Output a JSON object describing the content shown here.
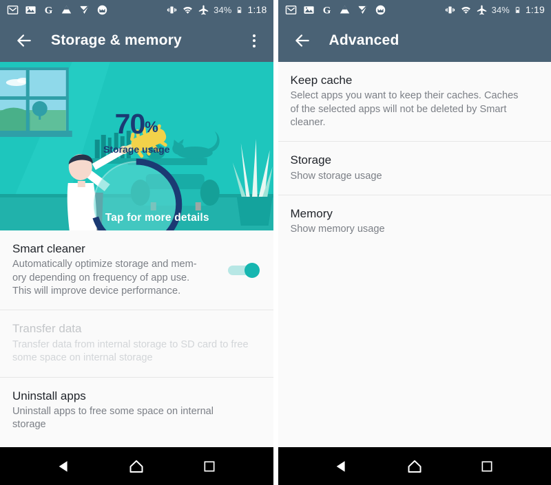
{
  "left": {
    "statusbar": {
      "icons": [
        "gmail-icon",
        "photos-icon",
        "google-icon",
        "drive-icon",
        "play-protect-icon",
        "package-icon"
      ],
      "vibrate_icon": "vibrate-icon",
      "wifi_icon": "wifi-icon",
      "airplane_icon": "airplane-mode-icon",
      "battery_percent": "34%",
      "battery_icon": "battery-icon",
      "time": "1:18"
    },
    "toolbar": {
      "back_icon": "back-arrow-icon",
      "title": "Storage & memory",
      "overflow_icon": "overflow-menu-icon"
    },
    "hero": {
      "percent": "70",
      "percent_symbol": "%",
      "ring_label": "Storage usage",
      "caption": "Tap for more details",
      "ring_value": 70,
      "ring_color": "#1b3a73",
      "bg_color": "#1ec6bd"
    },
    "rows": [
      {
        "title": "Smart cleaner",
        "subtitle": "Automatically optimize storage and mem-\nory depending on frequency of app use.\nThis will improve device performance.",
        "disabled": false,
        "toggle": "on"
      },
      {
        "title": "Transfer data",
        "subtitle": "Transfer data from internal storage to SD card to free\nsome space on internal storage",
        "disabled": true
      },
      {
        "title": "Uninstall apps",
        "subtitle": "Uninstall apps to free some space on internal\nstorage",
        "disabled": false
      }
    ]
  },
  "right": {
    "statusbar": {
      "icons": [
        "gmail-icon",
        "photos-icon",
        "google-icon",
        "drive-icon",
        "play-protect-icon",
        "package-icon"
      ],
      "battery_percent": "34%",
      "time": "1:19"
    },
    "toolbar": {
      "back_icon": "back-arrow-icon",
      "title": "Advanced"
    },
    "rows": [
      {
        "title": "Keep cache",
        "subtitle": "Select apps you want to keep their caches. Caches\nof the selected apps will not be deleted by Smart\ncleaner."
      },
      {
        "title": "Storage",
        "subtitle": "Show storage usage"
      },
      {
        "title": "Memory",
        "subtitle": "Show memory usage"
      }
    ]
  },
  "navbar": {
    "back": "nav-back-icon",
    "home": "nav-home-icon",
    "recents": "nav-recents-icon"
  },
  "colors": {
    "toolbar": "#4a6275",
    "accent_teal": "#16b6b0",
    "hero_bg": "#1ec6bd",
    "ring_navy": "#1b3a73"
  }
}
